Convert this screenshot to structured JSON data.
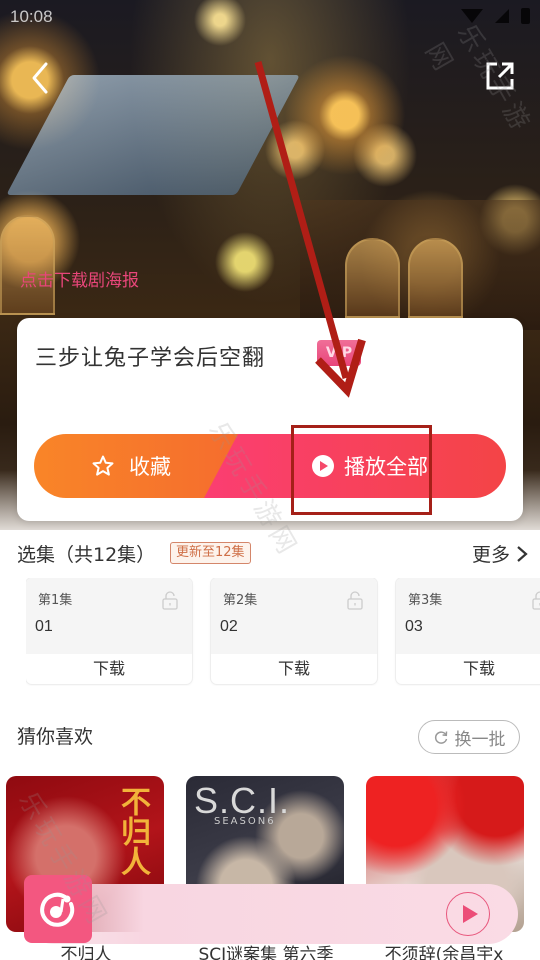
{
  "status_bar": {
    "time": "10:08",
    "icons": [
      "wifi-icon",
      "signal-icon",
      "battery-icon"
    ]
  },
  "header": {
    "back_icon": "chevron-left-icon",
    "share_icon": "share-external-icon",
    "poster_download_link": "点击下载剧海报"
  },
  "drama": {
    "title": "三步让兔子学会后空翻",
    "badge": "VIP",
    "favorite_label": "收藏",
    "play_all_label": "播放全部"
  },
  "episodes": {
    "title": "选集（共12集）",
    "update_badge": "更新至12集",
    "more_label": "更多",
    "items": [
      {
        "label": "第1集",
        "number": "01",
        "download": "下载",
        "locked": false
      },
      {
        "label": "第2集",
        "number": "02",
        "download": "下载",
        "locked": false
      },
      {
        "label": "第3集",
        "number": "03",
        "download": "下载",
        "locked": false
      }
    ]
  },
  "recommendations": {
    "title": "猜你喜欢",
    "refresh_label": "换一批",
    "items": [
      {
        "name": "不归人",
        "cover_text": "不归人"
      },
      {
        "name": "SCI谜案集 第六季",
        "cover_text": "S.C.I.",
        "cover_subtext": "SEASON6"
      },
      {
        "name": "不须辞(余昌宇x",
        "cover_text": ""
      }
    ]
  },
  "mini_player": {
    "logo_icon": "music-note-icon",
    "play_icon": "play-icon"
  },
  "watermark": "乐玩手游网",
  "colors": {
    "accent_pink": "#f35780",
    "favorite_orange": "#f98528",
    "play_red": "#f44446",
    "link_pink": "#e8467a",
    "badge_orange": "#cf7048"
  }
}
